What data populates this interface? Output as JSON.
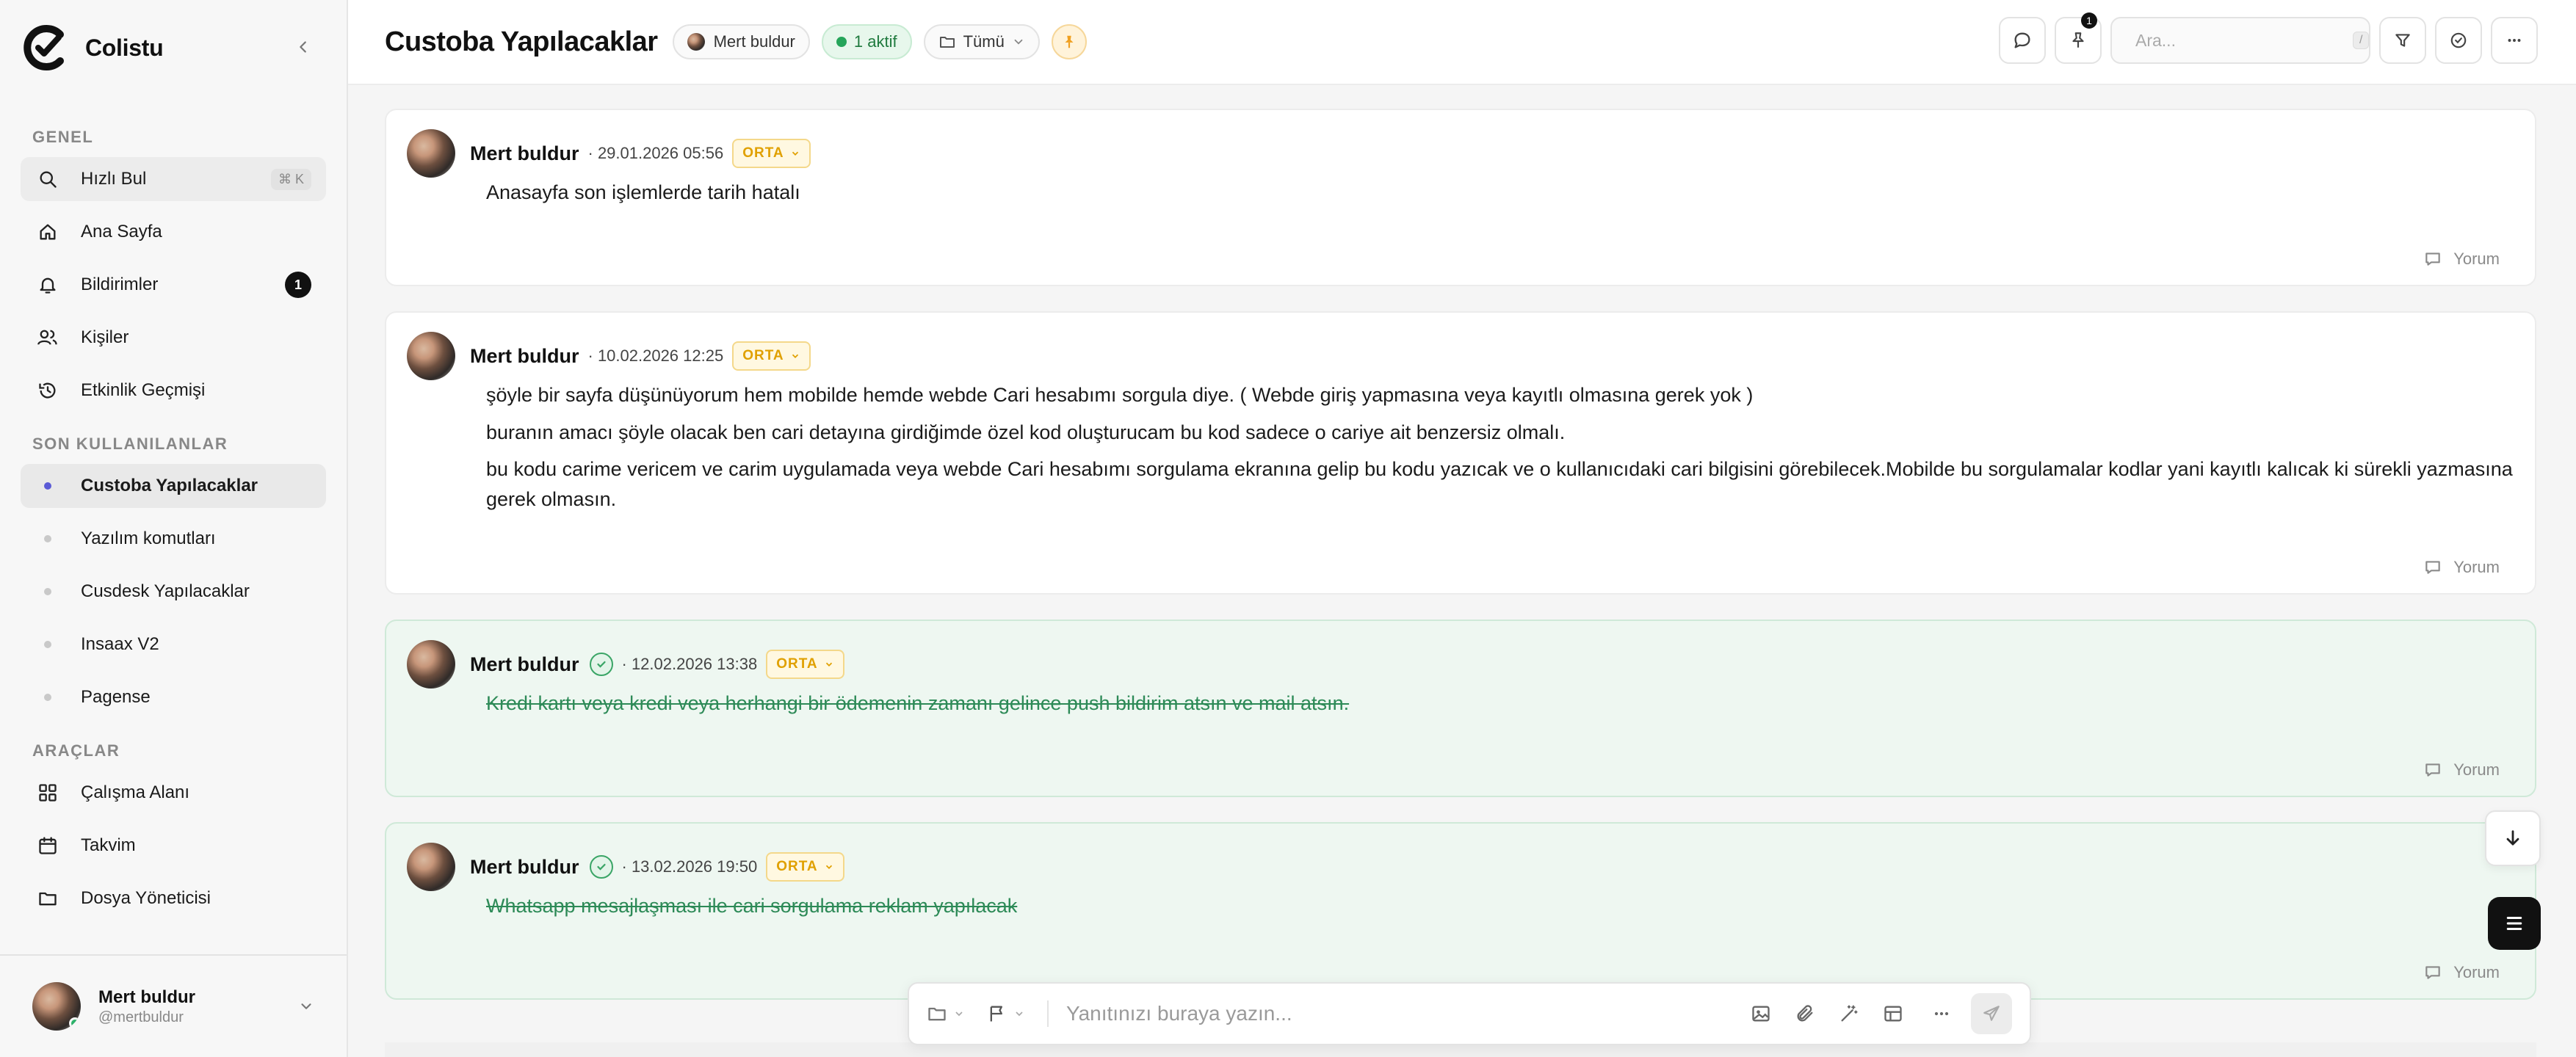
{
  "app": {
    "name": "Colistu"
  },
  "sidebar": {
    "sections": {
      "general": "GENEL",
      "recent": "SON KULLANILANLAR",
      "tools": "ARAÇLAR"
    },
    "general_items": [
      {
        "label": "Hızlı Bul",
        "shortcut": "⌘ K",
        "icon": "search-icon"
      },
      {
        "label": "Ana Sayfa",
        "icon": "home-icon"
      },
      {
        "label": "Bildirimler",
        "badge": "1",
        "icon": "bell-icon"
      },
      {
        "label": "Kişiler",
        "icon": "users-icon"
      },
      {
        "label": "Etkinlik Geçmişi",
        "icon": "history-icon"
      }
    ],
    "recent_items": [
      {
        "label": "Custoba Yapılacaklar",
        "active": true
      },
      {
        "label": "Yazılım komutları"
      },
      {
        "label": "Cusdesk Yapılacaklar"
      },
      {
        "label": "Insaax V2"
      },
      {
        "label": "Pagense"
      }
    ],
    "tool_items": [
      {
        "label": "Çalışma Alanı",
        "icon": "grid-icon"
      },
      {
        "label": "Takvim",
        "icon": "calendar-icon"
      },
      {
        "label": "Dosya Yöneticisi",
        "icon": "folder-icon"
      }
    ],
    "user": {
      "name": "Mert buldur",
      "handle": "@mertbuldur"
    }
  },
  "header": {
    "title": "Custoba Yapılacaklar",
    "owner_chip": "Mert buldur",
    "active_chip": "1 aktif",
    "filter_chip": "Tümü",
    "pin_badge": "1",
    "search_placeholder": "Ara...",
    "search_shortcut": "/"
  },
  "messages": [
    {
      "author": "Mert buldur",
      "timestamp": "· 29.01.2026 05:56",
      "priority": "ORTA",
      "done": false,
      "lines": [
        "Anasayfa son işlemlerde tarih hatalı"
      ],
      "comment_label": "Yorum"
    },
    {
      "author": "Mert buldur",
      "timestamp": "· 10.02.2026 12:25",
      "priority": "ORTA",
      "done": false,
      "lines": [
        "şöyle bir sayfa düşünüyorum hem mobilde hemde webde Cari hesabımı sorgula diye. ( Webde giriş yapmasına veya kayıtlı olmasına gerek yok )",
        "buranın amacı şöyle olacak ben cari detayına girdiğimde özel kod oluşturucam bu kod sadece o cariye ait benzersiz olmalı.",
        "bu kodu carime vericem ve carim uygulamada veya webde Cari hesabımı sorgulama ekranına gelip bu kodu yazıcak ve o kullanıcıdaki cari bilgisini görebilecek.Mobilde bu sorgulamalar kodlar yani kayıtlı kalıcak ki sürekli yazmasına gerek olmasın."
      ],
      "comment_label": "Yorum"
    },
    {
      "author": "Mert buldur",
      "timestamp": "· 12.02.2026 13:38",
      "priority": "ORTA",
      "done": true,
      "lines": [
        "Kredi kartı veya kredi veya herhangi bir ödemenin zamanı gelince push bildirim atsın ve mail atsın."
      ],
      "comment_label": "Yorum"
    },
    {
      "author": "Mert buldur",
      "timestamp": "· 13.02.2026 19:50",
      "priority": "ORTA",
      "done": true,
      "lines": [
        "Whatsapp mesajlaşması ile cari sorgulama reklam yapılacak"
      ],
      "comment_label": "Yorum"
    }
  ],
  "composer": {
    "placeholder": "Yanıtınızı buraya yazın..."
  }
}
